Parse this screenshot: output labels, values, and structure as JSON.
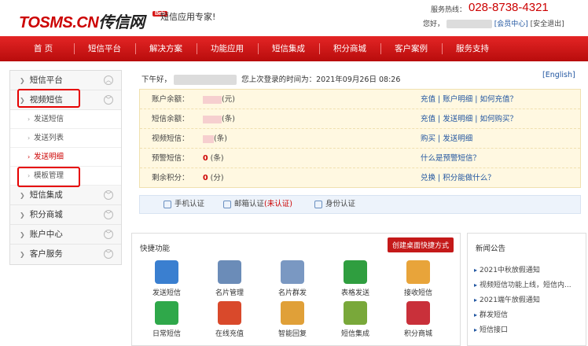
{
  "header": {
    "logo_main": "TOSMS.CN",
    "logo_cn": "传信网",
    "beta": "Beta",
    "slogan": "短信应用专家!",
    "hotline_label": "服务热线：",
    "hotline_number": "028-8738-4321",
    "greeting_prefix": "您好，",
    "member_center": "[会员中心]",
    "logout": "[安全退出]"
  },
  "nav": [
    "首 页",
    "短信平台",
    "解决方案",
    "功能应用",
    "短信集成",
    "积分商城",
    "客户案例",
    "服务支持"
  ],
  "sidebar": {
    "items": [
      {
        "label": "短信平台",
        "toggle": "︿"
      },
      {
        "label": "视频短信",
        "toggle": "﹀"
      },
      {
        "label": "短信集成",
        "toggle": "﹀"
      },
      {
        "label": "积分商城",
        "toggle": "﹀"
      },
      {
        "label": "账户中心",
        "toggle": "﹀"
      },
      {
        "label": "客户服务",
        "toggle": "﹀"
      }
    ],
    "subs": [
      "发送短信",
      "发送列表",
      "发送明细",
      "模板管理"
    ]
  },
  "main": {
    "greeting": "下午好，",
    "last_login_label": "您上次登录的时间为：",
    "last_login_time": "2021年09月26日 08:26",
    "lang_toggle": "[English]"
  },
  "account": [
    {
      "label": "账户余额：",
      "value": "",
      "unit": "(元)",
      "links": "充值 | 账户明细 | 如何充值？"
    },
    {
      "label": "短信余额：",
      "value": "",
      "unit": "(条)",
      "links": "充值 | 发送明细 | 如何购买？"
    },
    {
      "label": "视频短信：",
      "value": "",
      "unit": "(条)",
      "links": "购买 | 发送明细"
    },
    {
      "label": "预警短信：",
      "value": "0",
      "unit": "(条)",
      "links": "什么是预警短信？"
    },
    {
      "label": "剩余积分：",
      "value": "0",
      "unit": "(分)",
      "links": "兑换 | 积分能做什么？"
    }
  ],
  "verify": {
    "phone": "手机认证",
    "email": "邮箱认证",
    "email_status": "(未认证)",
    "id": "身份认证"
  },
  "quick": {
    "title": "快捷功能",
    "shortcut_button": "创建桌面快捷方式",
    "items": [
      {
        "label": "发送短信",
        "icon": "phone-icon",
        "color": "#3a7fd0"
      },
      {
        "label": "名片管理",
        "icon": "contact-card-icon",
        "color": "#6b8cb8"
      },
      {
        "label": "名片群发",
        "icon": "group-card-icon",
        "color": "#7a98c2"
      },
      {
        "label": "表格发送",
        "icon": "excel-icon",
        "color": "#2f9e3f"
      },
      {
        "label": "接收短信",
        "icon": "inbox-envelope-icon",
        "color": "#e8a43a"
      },
      {
        "label": "日常短信",
        "icon": "sms-icon",
        "color": "#2fa84a"
      },
      {
        "label": "在线充值",
        "icon": "shopping-cart-icon",
        "color": "#d9492b"
      },
      {
        "label": "智能回复",
        "icon": "reply-envelope-icon",
        "color": "#e0a038"
      },
      {
        "label": "短信集成",
        "icon": "disc-icon",
        "color": "#79a83a"
      },
      {
        "label": "积分商城",
        "icon": "gift-icon",
        "color": "#c9303a"
      }
    ]
  },
  "news": {
    "title": "新闻公告",
    "items": [
      "2021中秋放假通知",
      "视频短信功能上线，短信内...",
      "2021端午放假通知",
      "群发短信",
      "短信接口"
    ]
  }
}
